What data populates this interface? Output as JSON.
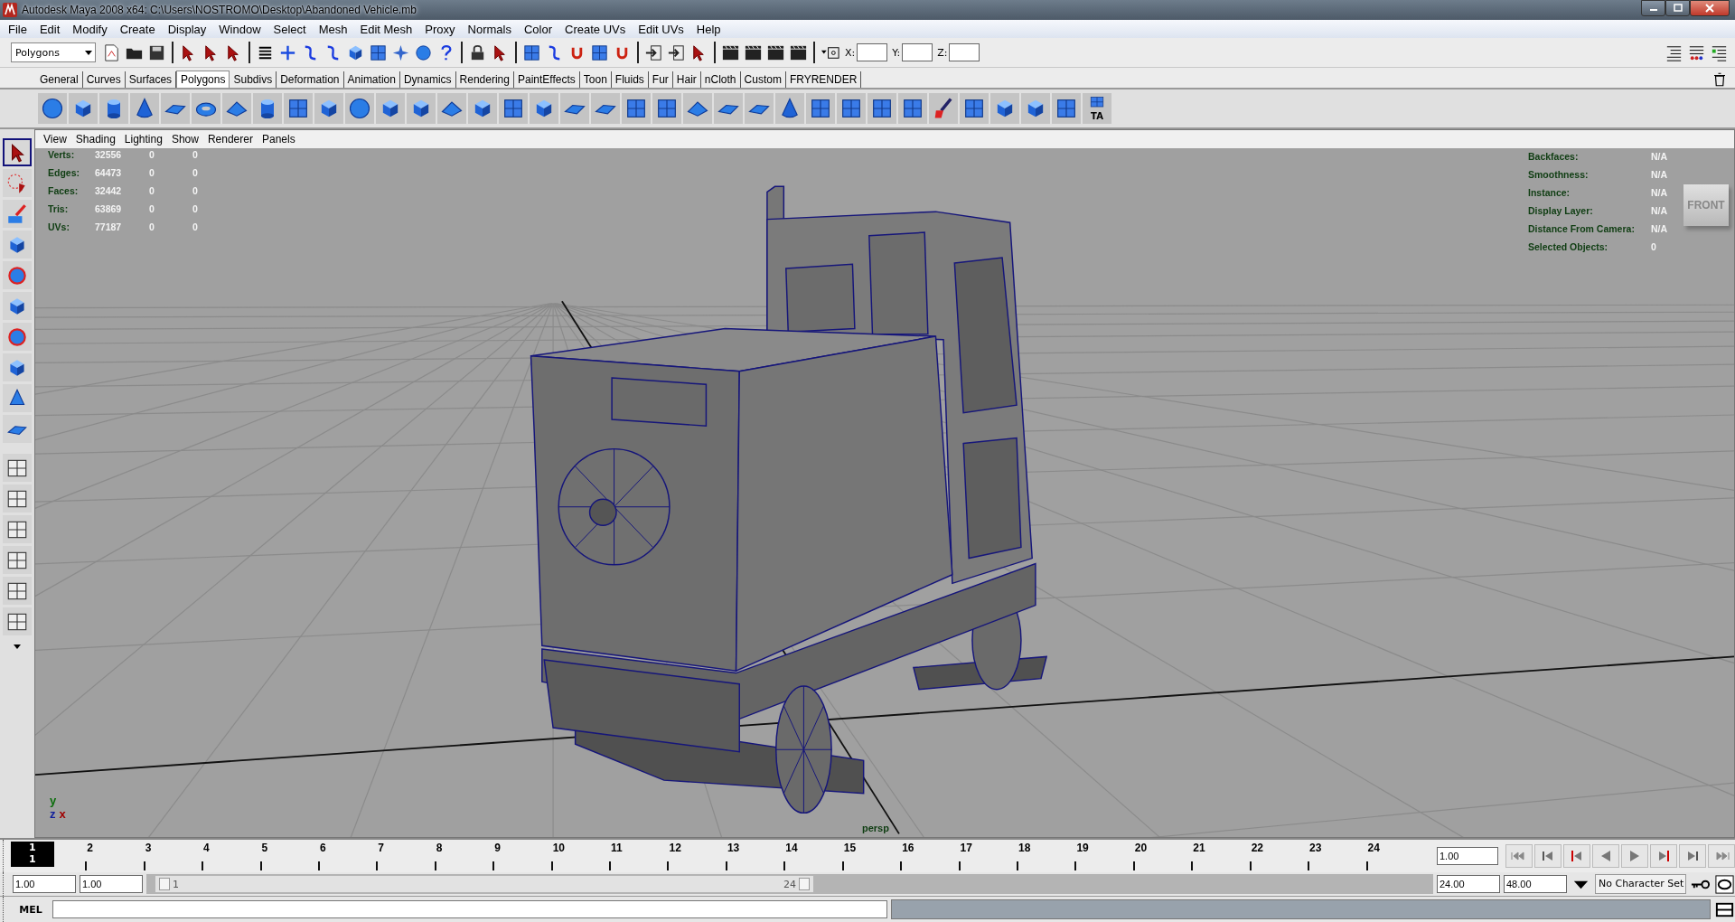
{
  "window": {
    "title": "Autodesk Maya 2008 x64: C:\\Users\\NOSTROMO\\Desktop\\Abandoned Vehicle.mb"
  },
  "menu_bar": [
    "File",
    "Edit",
    "Modify",
    "Create",
    "Display",
    "Window",
    "Select",
    "Mesh",
    "Edit Mesh",
    "Proxy",
    "Normals",
    "Color",
    "Create UVs",
    "Edit UVs",
    "Help"
  ],
  "status_line": {
    "mode_selector": "Polygons",
    "coordinate_fields": [
      {
        "label": "X:"
      },
      {
        "label": "Y:"
      },
      {
        "label": "Z:"
      }
    ]
  },
  "shelf": {
    "tabs": [
      {
        "label": "General",
        "selected": false
      },
      {
        "label": "Curves",
        "selected": false
      },
      {
        "label": "Surfaces",
        "selected": false
      },
      {
        "label": "Polygons",
        "selected": true
      },
      {
        "label": "Subdivs",
        "selected": false
      },
      {
        "label": "Deformation",
        "selected": false
      },
      {
        "label": "Animation",
        "selected": false
      },
      {
        "label": "Dynamics",
        "selected": false
      },
      {
        "label": "Rendering",
        "selected": false
      },
      {
        "label": "PaintEffects",
        "selected": false
      },
      {
        "label": "Toon",
        "selected": false
      },
      {
        "label": "Fluids",
        "selected": false
      },
      {
        "label": "Fur",
        "selected": false
      },
      {
        "label": "Hair",
        "selected": false
      },
      {
        "label": "nCloth",
        "selected": false
      },
      {
        "label": "Custom",
        "selected": false
      },
      {
        "label": "FRYRENDER",
        "selected": false
      }
    ],
    "last_icon_label": "TA"
  },
  "viewport": {
    "menu": [
      "View",
      "Shading",
      "Lighting",
      "Show",
      "Renderer",
      "Panels"
    ],
    "hud_left": [
      {
        "label": "Verts:",
        "values": [
          "32556",
          "0",
          "0"
        ]
      },
      {
        "label": "Edges:",
        "values": [
          "64473",
          "0",
          "0"
        ]
      },
      {
        "label": "Faces:",
        "values": [
          "32442",
          "0",
          "0"
        ]
      },
      {
        "label": "Tris:",
        "values": [
          "63869",
          "0",
          "0"
        ]
      },
      {
        "label": "UVs:",
        "values": [
          "77187",
          "0",
          "0"
        ]
      }
    ],
    "hud_right": [
      {
        "label": "Backfaces:",
        "value": "N/A"
      },
      {
        "label": "Smoothness:",
        "value": "N/A"
      },
      {
        "label": "Instance:",
        "value": "N/A"
      },
      {
        "label": "Display Layer:",
        "value": "N/A"
      },
      {
        "label": "Distance From Camera:",
        "value": "N/A"
      },
      {
        "label": "Selected Objects:",
        "value": "0"
      }
    ],
    "view_cube": "FRONT",
    "camera": "persp",
    "axes": [
      "y",
      "z",
      "x"
    ]
  },
  "time_slider": {
    "frames": [
      "1",
      "2",
      "3",
      "4",
      "5",
      "6",
      "7",
      "8",
      "9",
      "10",
      "11",
      "12",
      "13",
      "14",
      "15",
      "16",
      "17",
      "18",
      "19",
      "20",
      "21",
      "22",
      "23",
      "24"
    ],
    "current_frame": "1",
    "current_time": "1.00"
  },
  "range_slider": {
    "start_time": "1.00",
    "playback_start": "1.00",
    "start_label": "1",
    "end_label": "24",
    "playback_end": "24.00",
    "end_time": "48.00",
    "character_set": "No Character Set"
  },
  "command_line": {
    "label": "MEL"
  }
}
